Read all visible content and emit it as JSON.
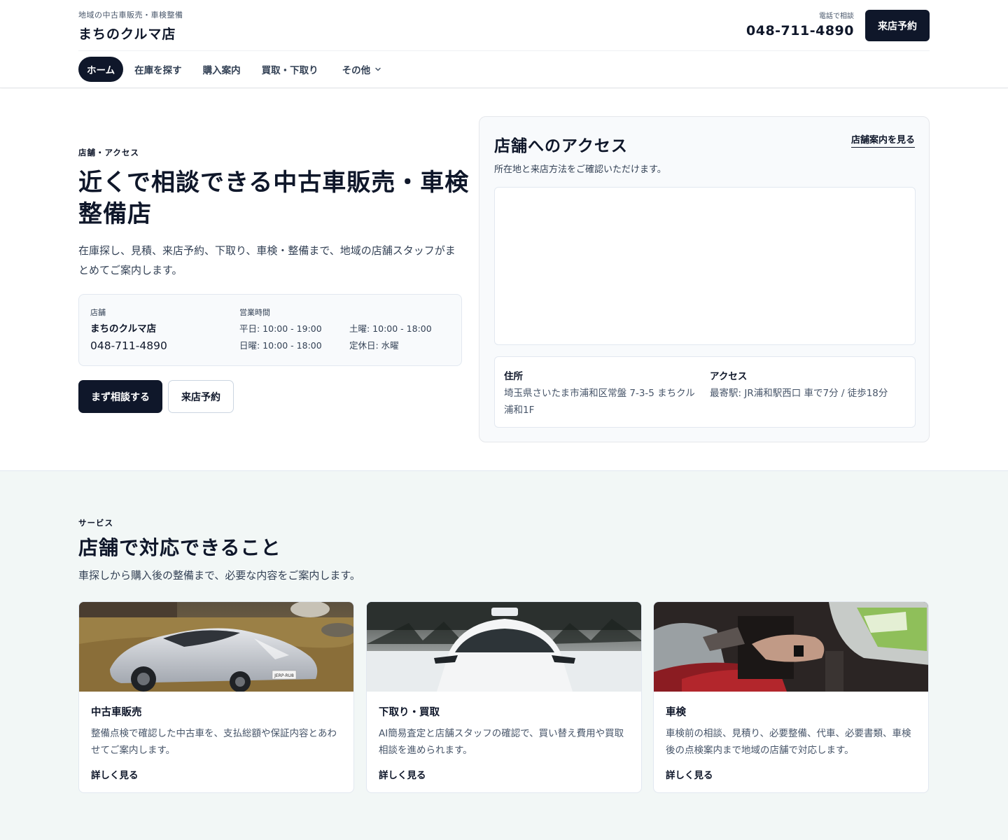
{
  "header": {
    "tagline": "地域の中古車販売・車検整備",
    "shop_name": "まちのクルマ店",
    "phone_label": "電話で相談",
    "phone_number": "048-711-4890",
    "cta_label": "来店予約"
  },
  "nav": {
    "items": [
      {
        "label": "ホーム",
        "active": true
      },
      {
        "label": "在庫を探す",
        "active": false
      },
      {
        "label": "購入案内",
        "active": false
      },
      {
        "label": "買取・下取り",
        "active": false
      },
      {
        "label": "その他",
        "active": false
      }
    ]
  },
  "hero": {
    "eyebrow": "店舗・アクセス",
    "title": "近くで相談できる中古車販売・車検整備店",
    "description": "在庫探し、見積、来店予約、下取り、車検・整備まで、地域の店舗スタッフがまとめてご案内します。",
    "info": {
      "shop_label": "店舗",
      "shop_name": "まちのクルマ店",
      "phone": "048-711-4890",
      "hours_label": "営業時間",
      "weekday": "平日: 10:00 - 19:00",
      "saturday": "土曜: 10:00 - 18:00",
      "sunday": "日曜: 10:00 - 18:00",
      "closed": "定休日: 水曜"
    },
    "primary_button": "まず相談する",
    "secondary_button": "来店予約"
  },
  "access": {
    "title": "店舗へのアクセス",
    "link": "店舗案内を見る",
    "subtitle": "所在地と来店方法をご確認いただけます。",
    "address_label": "住所",
    "address": "埼玉県さいたま市浦和区常盤 7-3-5 まちクル浦和1F",
    "access_label": "アクセス",
    "access_text": "最寄駅: JR浦和駅西口 車で7分 / 徒歩18分"
  },
  "services": {
    "eyebrow": "サービス",
    "title": "店舗で対応できること",
    "description": "車探しから購入後の整備まで、必要な内容をご案内します。",
    "cards": [
      {
        "title": "中古車販売",
        "text": "整備点検で確認した中古車を、支払総額や保証内容とあわせてご案内します。",
        "link": "詳しく見る",
        "plate": "JERP-RU8"
      },
      {
        "title": "下取り・買取",
        "text": "AI簡易査定と店舗スタッフの確認で、買い替え費用や買取相談を進められます。",
        "link": "詳しく見る"
      },
      {
        "title": "車検",
        "text": "車検前の相談、見積り、必要整備、代車、必要書類、車検後の点検案内まで地域の店舗で対応します。",
        "link": "詳しく見る"
      }
    ]
  },
  "colors": {
    "primary": "#0f172a",
    "services_bg": "#f2f7f6",
    "panel_bg": "#f8fafc",
    "border": "#e2e8f0"
  }
}
